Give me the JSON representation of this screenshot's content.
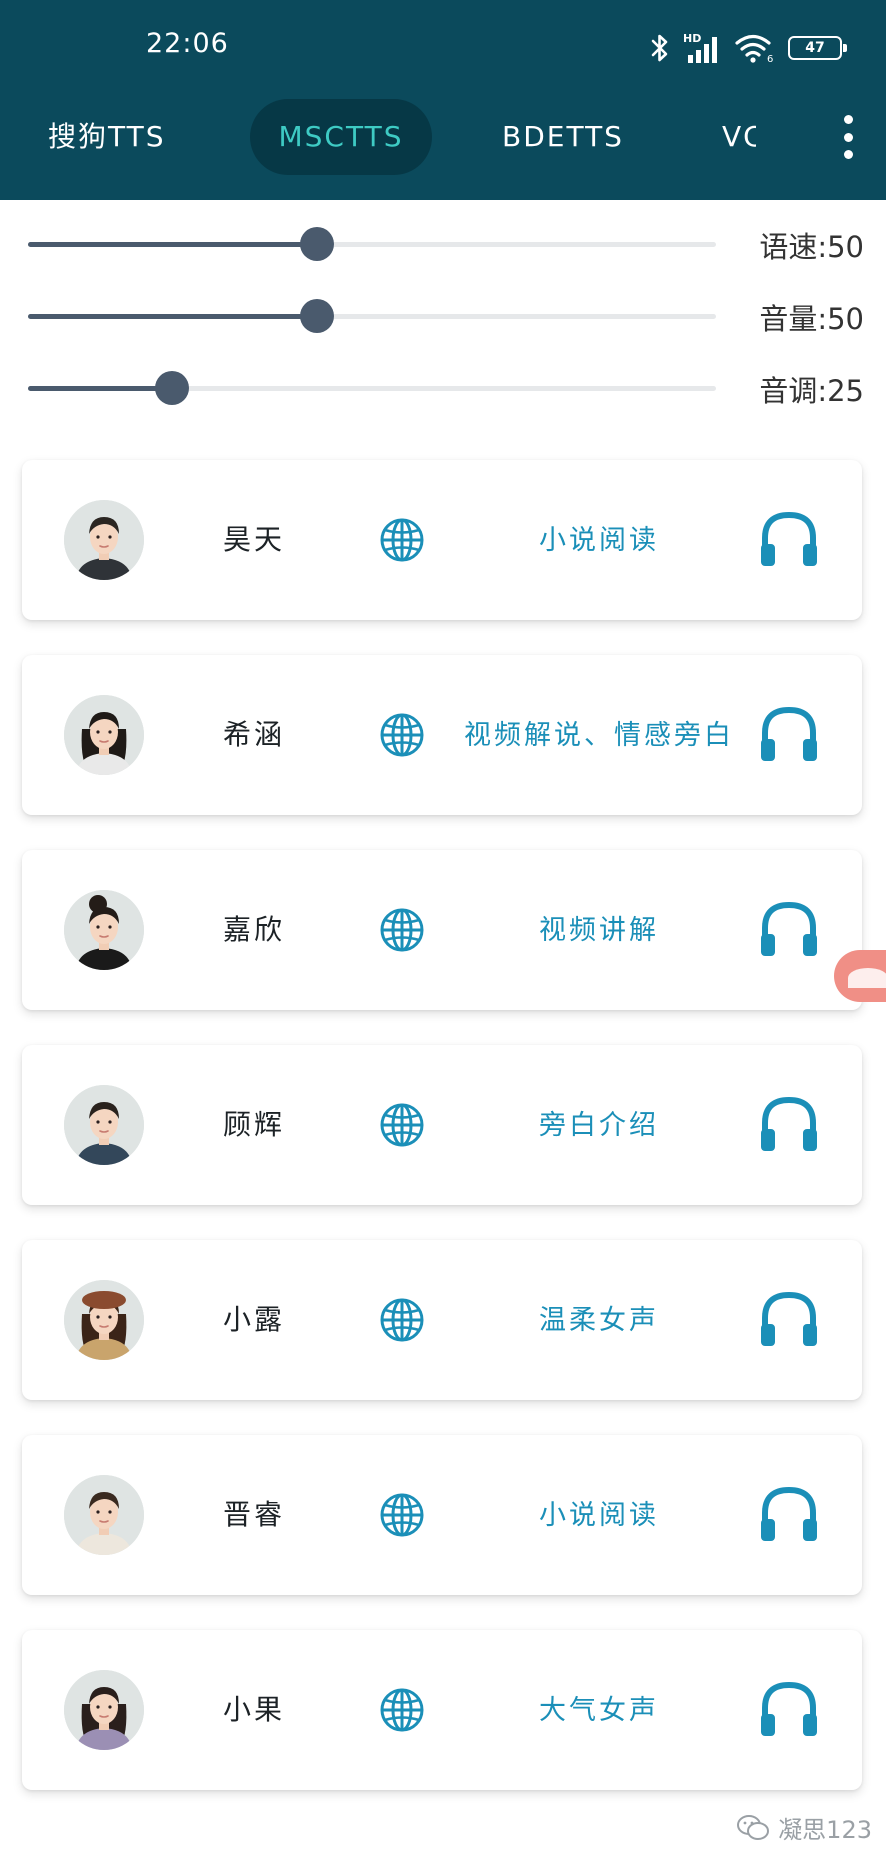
{
  "status_bar": {
    "time": "22:06",
    "network_label": "HD",
    "signal_sub": "6",
    "battery": "47"
  },
  "tabs": [
    {
      "label": "搜狗TTS",
      "active": false
    },
    {
      "label": "MSCTTS",
      "active": true
    },
    {
      "label": "BDETTS",
      "active": false
    },
    {
      "label": "VC",
      "active": false
    }
  ],
  "sliders": [
    {
      "label": "语速:50",
      "value_fraction": 0.5
    },
    {
      "label": "音量:50",
      "value_fraction": 0.5
    },
    {
      "label": "音调:25",
      "value_fraction": 0.25
    }
  ],
  "voices": [
    {
      "name": "昊天",
      "description": "小说阅读",
      "avatar": "male-short-hair"
    },
    {
      "name": "希涵",
      "description": "视频解说、情感旁白",
      "avatar": "female-long-hair"
    },
    {
      "name": "嘉欣",
      "description": "视频讲解",
      "avatar": "female-updo"
    },
    {
      "name": "顾辉",
      "description": "旁白介绍",
      "avatar": "male-suit"
    },
    {
      "name": "小露",
      "description": "温柔女声",
      "avatar": "female-beret"
    },
    {
      "name": "晋睿",
      "description": "小说阅读",
      "avatar": "male-casual"
    },
    {
      "name": "小果",
      "description": "大气女声",
      "avatar": "female-short-hair"
    }
  ],
  "watermark": "凝思123",
  "colors": {
    "header": "#0b4a5c",
    "active_tab_bg": "#063846",
    "active_tab_text": "#3ecbc4",
    "accent_blue": "#1b8fb8",
    "slider": "#4a5a6d"
  },
  "icons": {
    "globe": "globe-icon",
    "listen": "headphones-icon",
    "menu": "more-vert-icon"
  }
}
